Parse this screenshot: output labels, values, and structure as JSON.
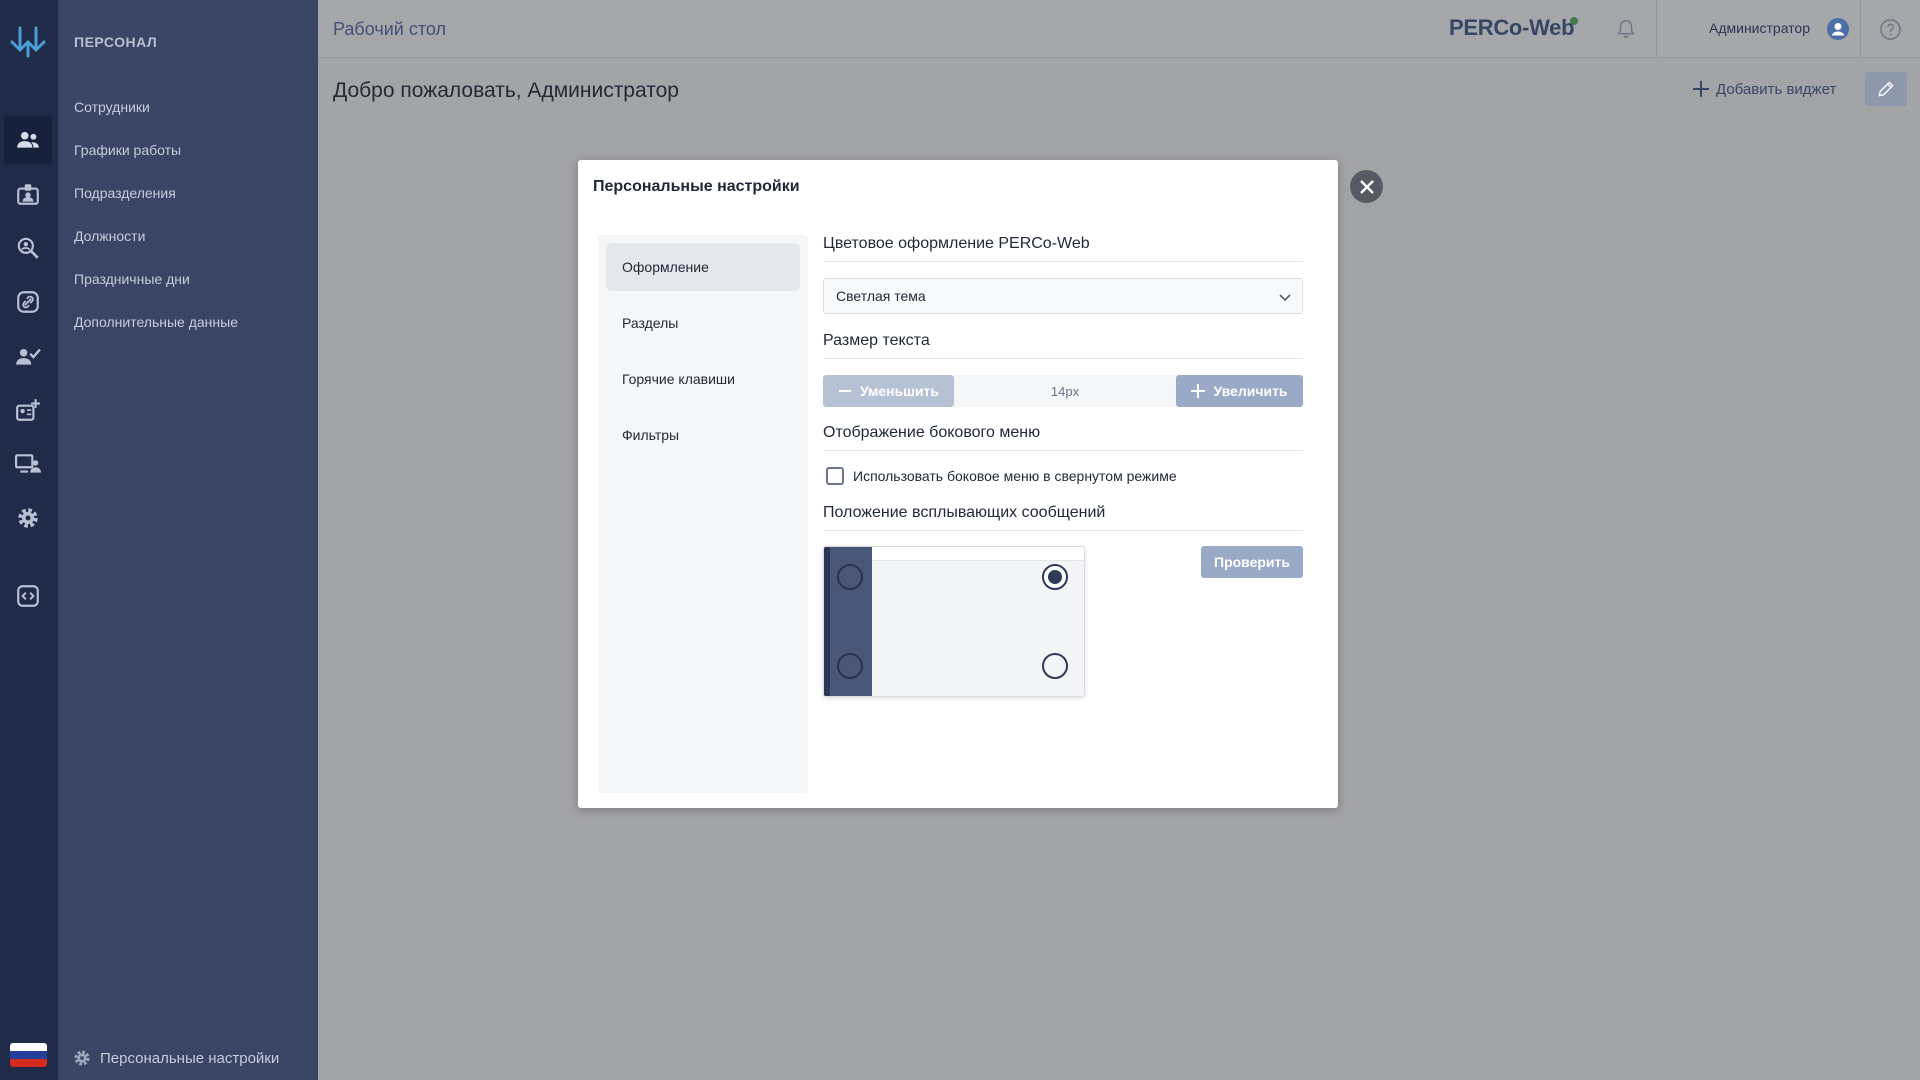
{
  "header": {
    "page_title": "Рабочий стол",
    "brand": "PERCo-Web",
    "user_name": "Администратор"
  },
  "sidebar": {
    "section_title": "ПЕРСОНАЛ",
    "items": [
      {
        "label": "Сотрудники"
      },
      {
        "label": "Графики работы"
      },
      {
        "label": "Подразделения"
      },
      {
        "label": "Должности"
      },
      {
        "label": "Праздничные дни"
      },
      {
        "label": "Дополнительные данные"
      }
    ],
    "bottom_label": "Персональные настройки"
  },
  "rail": {
    "icons": [
      "people-icon",
      "badge-icon",
      "search-person-icon",
      "link-icon",
      "person-check-icon",
      "id-card-add-icon",
      "monitor-person-icon",
      "gear-icon",
      "code-icon"
    ],
    "flag_colors": [
      "#ffffff",
      "#233f99",
      "#d52b1e"
    ]
  },
  "main": {
    "welcome": "Добро пожаловать, Администратор",
    "add_widget": "Добавить виджет"
  },
  "modal": {
    "title": "Персональные настройки",
    "menu": [
      {
        "label": "Оформление",
        "active": true
      },
      {
        "label": "Разделы"
      },
      {
        "label": "Горячие клавиши"
      },
      {
        "label": "Фильтры"
      }
    ],
    "color_scheme": {
      "title": "Цветовое оформление PERCo-Web",
      "value": "Светлая тема"
    },
    "text_size": {
      "title": "Размер текста",
      "decrease": "Уменьшить",
      "value": "14px",
      "increase": "Увеличить"
    },
    "side_menu": {
      "title": "Отображение бокового меню",
      "checkbox_label": "Использовать боковое меню в свернутом режиме",
      "checked": false
    },
    "notifications": {
      "title": "Положение всплывающих сообщений",
      "selected": "top-right",
      "test_button": "Проверить"
    }
  },
  "colors": {
    "rail_bg": "#202b4a",
    "sidebar_bg": "#3a4566",
    "accent": "#9aa9c6"
  }
}
